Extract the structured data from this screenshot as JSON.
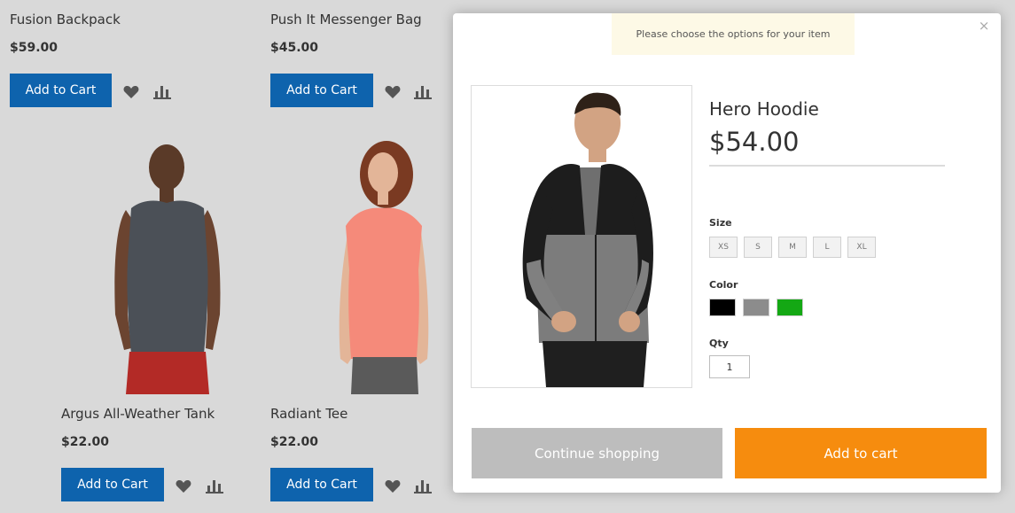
{
  "products": [
    {
      "name": "Fusion Backpack",
      "price": "$59.00",
      "button": "Add to Cart"
    },
    {
      "name": "Push It Messenger Bag",
      "price": "$45.00",
      "button": "Add to Cart"
    },
    {
      "name": "Argus All-Weather Tank",
      "price": "$22.00",
      "button": "Add to Cart"
    },
    {
      "name": "Radiant Tee",
      "price": "$22.00",
      "button": "Add to Cart"
    }
  ],
  "modal": {
    "notice": "Please choose the options for your item",
    "close_icon": "×",
    "title": "Hero Hoodie",
    "price": "$54.00",
    "size_label": "Size",
    "sizes": [
      "XS",
      "S",
      "M",
      "L",
      "XL"
    ],
    "color_label": "Color",
    "colors": [
      "#000000",
      "#8c8c8c",
      "#14a814"
    ],
    "qty_label": "Qty",
    "qty_value": "1",
    "continue_label": "Continue shopping",
    "add_label": "Add to cart"
  },
  "icons": {
    "wishlist": "heart-icon",
    "compare": "bar-chart-icon"
  },
  "colors": {
    "background": "#d9d9d9",
    "primary_button": "#0e63ad",
    "accent_button": "#f68c0e",
    "muted_button": "#bdbdbd"
  }
}
